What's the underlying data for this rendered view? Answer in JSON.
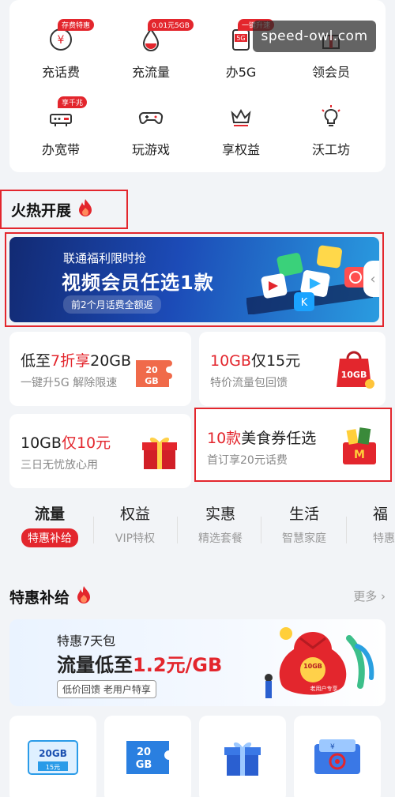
{
  "services": [
    {
      "label": "充话费",
      "tag": "存费特惠",
      "icon": "phone-bill-icon"
    },
    {
      "label": "充流量",
      "tag": "0.01元5GB",
      "icon": "data-drop-icon"
    },
    {
      "label": "办5G",
      "tag": "一键升速",
      "icon": "5g-sim-icon"
    },
    {
      "label": "领会员",
      "tag": "",
      "icon": "gift-member-icon"
    },
    {
      "label": "办宽带",
      "tag": "享千兆",
      "icon": "router-icon"
    },
    {
      "label": "玩游戏",
      "tag": "",
      "icon": "gamepad-icon"
    },
    {
      "label": "享权益",
      "tag": "",
      "icon": "crown-icon"
    },
    {
      "label": "沃工坊",
      "tag": "",
      "icon": "lightbulb-icon"
    }
  ],
  "watermark": "speed-owl.com",
  "hot_section": {
    "title": "火热开展"
  },
  "hot_banner": {
    "line1": "联通福利限时抢",
    "line2": "视频会员任选1款",
    "line3": "前2个月话费全额返"
  },
  "promos": [
    {
      "title_pre": "低至",
      "title_red": "7折享",
      "title_post": "20GB",
      "sub": "一键升5G 解除限速"
    },
    {
      "title_pre": "",
      "title_red": "10GB",
      "title_post": "仅15元",
      "sub": "特价流量包回馈"
    },
    {
      "title_pre": "10GB",
      "title_red": "仅10元",
      "title_post": "",
      "sub": "三日无忧放心用"
    },
    {
      "title_pre": "",
      "title_red": "10款",
      "title_post": "美食券任选",
      "sub": "首订享20元话费"
    }
  ],
  "tabs": [
    {
      "title": "流量",
      "sub": "特惠补给"
    },
    {
      "title": "权益",
      "sub": "VIP特权"
    },
    {
      "title": "实惠",
      "sub": "精选套餐"
    },
    {
      "title": "生活",
      "sub": "智慧家庭"
    },
    {
      "title": "福",
      "sub": "特惠"
    }
  ],
  "special_section": {
    "title": "特惠补给",
    "more": "更多"
  },
  "special_banner": {
    "line1": "特惠7天包",
    "line2_pre": "流量低至",
    "line2_red": "1.2元/GB",
    "line3": "低价回馈  老用户特享",
    "bag_label1": "10GB",
    "bag_label2": "老用户专享"
  },
  "tiles": [
    {
      "icon": "data-ticket-icon",
      "t1": "20GB",
      "t2": "15元"
    },
    {
      "icon": "data-coupon-icon",
      "t1": "20",
      "t2": "GB"
    },
    {
      "icon": "gift-box-icon"
    },
    {
      "icon": "unicom-coupon-icon"
    }
  ],
  "colors": {
    "accent": "#e3262d",
    "banner_blue": "#1c4bb7",
    "bg": "#f2f4f7"
  }
}
